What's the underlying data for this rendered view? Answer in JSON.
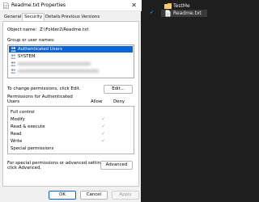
{
  "window": {
    "title": "Readme.txt Properties",
    "close_glyph": "✕"
  },
  "tabs": [
    {
      "label": "General",
      "active": false
    },
    {
      "label": "Security",
      "active": true
    },
    {
      "label": "Details",
      "active": false
    },
    {
      "label": "Previous Versions",
      "active": false
    }
  ],
  "security": {
    "object_name_label": "Object name:",
    "object_name_value": "Z:\\Folder2\\Readme.txt",
    "group_label": "Group or user names:",
    "users": [
      {
        "name": "Authenticated Users",
        "selected": true,
        "icon": "users-group-icon"
      },
      {
        "name": "SYSTEM",
        "selected": false,
        "icon": "users-group-icon"
      },
      {
        "name": "",
        "selected": false,
        "icon": "users-group-icon",
        "blurred": true
      },
      {
        "name": "",
        "selected": false,
        "icon": "users-group-icon",
        "blurred": true
      }
    ],
    "change_text": "To change permissions, click Edit.",
    "edit_button": "Edit...",
    "permissions_label_line1": "Permissions for Authenticated",
    "permissions_label_line2": "Users",
    "allow_header": "Allow",
    "deny_header": "Deny",
    "permissions": [
      {
        "name": "Full control",
        "allow": false
      },
      {
        "name": "Modify",
        "allow": true
      },
      {
        "name": "Read & execute",
        "allow": true
      },
      {
        "name": "Read",
        "allow": true
      },
      {
        "name": "Write",
        "allow": true
      },
      {
        "name": "Special permissions",
        "allow": false
      }
    ],
    "advanced_text_line1": "For special permissions or advanced settings,",
    "advanced_text_line2": "click Advanced.",
    "advanced_button": "Advanced"
  },
  "footer": {
    "ok": "OK",
    "cancel": "Cancel",
    "apply": "Apply"
  },
  "explorer": {
    "items": [
      {
        "name": "TestMe",
        "type": "folder",
        "selected": false
      },
      {
        "name": "Readme.txt",
        "type": "file",
        "selected": true
      }
    ],
    "check_glyph": "✓"
  },
  "colors": {
    "accent": "#0a64d8",
    "folder": "#f2c14e",
    "dark_bg": "#1e1e1e"
  }
}
